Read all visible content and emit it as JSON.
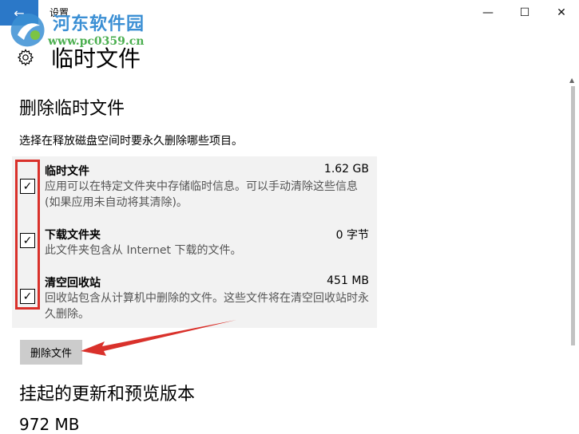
{
  "window": {
    "back_glyph": "←",
    "title": "设置",
    "minimize_glyph": "—",
    "maximize_glyph": "☐",
    "close_glyph": "✕"
  },
  "watermark": {
    "text": "河东软件园",
    "url": "www.pc0359.cn"
  },
  "page": {
    "title": "临时文件",
    "icon": "gear-icon"
  },
  "temp_section": {
    "title": "删除临时文件",
    "description": "选择在释放磁盘空间时要永久删除哪些项目。",
    "items": [
      {
        "name": "临时文件",
        "size": "1.62 GB",
        "description": "应用可以在特定文件夹中存储临时信息。可以手动清除这些信息(如果应用未自动将其清除)。",
        "checked": true,
        "check_glyph": "✓"
      },
      {
        "name": "下载文件夹",
        "size": "0 字节",
        "description": "此文件夹包含从 Internet 下载的文件。",
        "checked": true,
        "check_glyph": "✓"
      },
      {
        "name": "清空回收站",
        "size": "451 MB",
        "description": "回收站包含从计算机中删除的文件。这些文件将在清空回收站时永久删除。",
        "checked": true,
        "check_glyph": "✓"
      }
    ],
    "delete_button": "删除文件"
  },
  "pending_section": {
    "title": "挂起的更新和预览版本",
    "size": "972 MB"
  },
  "colors": {
    "accent": "#2b78c8",
    "annotation_red": "#d9312b",
    "panel_bg": "#f2f2f2",
    "button_bg": "#cccccc"
  }
}
